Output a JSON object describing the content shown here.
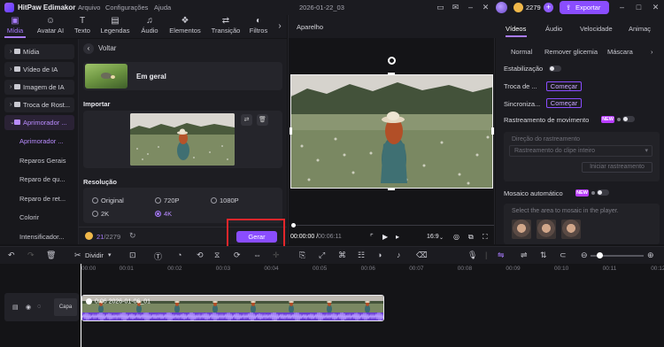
{
  "app": {
    "name": "HitPaw Edimakor",
    "menus": [
      "Arquivo",
      "Configurações",
      "Ajuda"
    ],
    "document": "2026-01-22_03",
    "credits": "2279",
    "export_label": "Exportar"
  },
  "toolbar": {
    "tabs": [
      {
        "label": "Mídia",
        "icon": "media-icon"
      },
      {
        "label": "Avatar AI",
        "icon": "avatar-icon"
      },
      {
        "label": "Texto",
        "icon": "text-icon"
      },
      {
        "label": "Legendas",
        "icon": "subtitles-icon"
      },
      {
        "label": "Áudio",
        "icon": "audio-icon"
      },
      {
        "label": "Elementos",
        "icon": "elements-icon"
      },
      {
        "label": "Transição",
        "icon": "transition-icon"
      },
      {
        "label": "Filtros",
        "icon": "filters-icon"
      }
    ],
    "active": "Mídia"
  },
  "sidebar": {
    "items": [
      {
        "label": "Mídia"
      },
      {
        "label": "Vídeo de IA"
      },
      {
        "label": "Imagem de IA"
      },
      {
        "label": "Troca de Rost..."
      },
      {
        "label": "Aprimorador ..."
      }
    ],
    "subitems": [
      "Aprimorador ...",
      "Reparos Gerais",
      "Reparo de qu...",
      "Reparo de ret...",
      "Colorir",
      "Intensificador..."
    ]
  },
  "center": {
    "back_label": "Voltar",
    "model_label": "Em geral",
    "import_label": "Importar",
    "resolution_label": "Resolução",
    "resolutions": [
      "Original",
      "720P",
      "1080P",
      "2K",
      "4K"
    ],
    "selected_resolution": "4K",
    "credits_used": "21",
    "credits_total": "/2279",
    "generate_label": "Gerar"
  },
  "player": {
    "title": "Aparelho",
    "time_current": "00:00:00",
    "time_separator": "/",
    "time_total": "00:06:11",
    "ratio": "16:9"
  },
  "right_panel": {
    "tabs": [
      "Vídeos",
      "Áudio",
      "Velocidade",
      "Animaç"
    ],
    "active_tab": "Vídeos",
    "subtabs": [
      "Normal",
      "Remover glicemia",
      "Máscara"
    ],
    "stabilization_label": "Estabilização",
    "face_swap_label": "Troca de ...",
    "sync_label": "Sincroniza...",
    "begin_label": "Começar",
    "motion_tracking_label": "Rastreamento de movimento",
    "new_badge": "NEW",
    "track_direction_label": "Direção do rastreamento",
    "track_select_value": "Rastreamento do clipe inteiro",
    "start_tracking_label": "Iniciar rastreamento",
    "auto_mosaic_label": "Mosaico automático",
    "mosaic_hint": "Select the area to mosaic in the player."
  },
  "timeline": {
    "split_label": "Dividir",
    "ruler": [
      "00:00",
      "00:01",
      "00:02",
      "00:03",
      "00:04",
      "00:05",
      "00:06",
      "00:07",
      "00:08",
      "00:09",
      "00:10",
      "00:11",
      "00:12"
    ],
    "track_label": "Capa",
    "clip_label": "0:06  2026-01-06_01"
  },
  "colors": {
    "accent": "#8a4dff",
    "highlight": "#e5262b",
    "background": "#141417"
  }
}
